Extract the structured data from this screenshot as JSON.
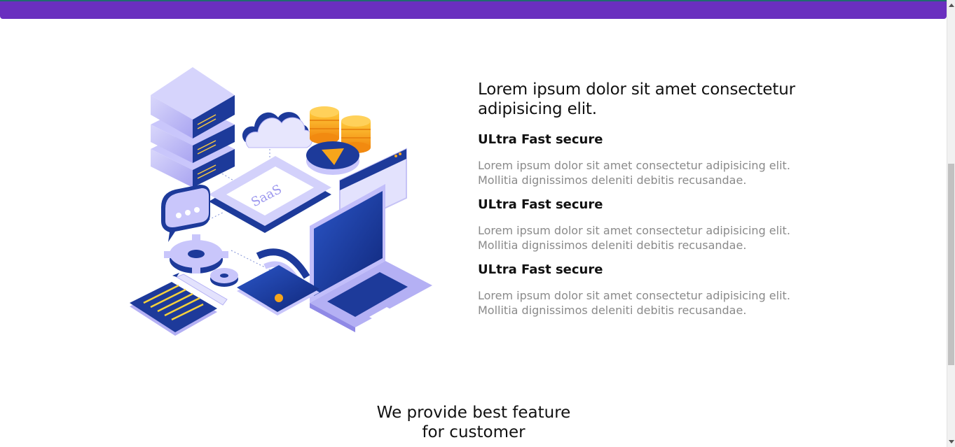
{
  "colors": {
    "topbar": "#6a2fbf",
    "heading": "#111111",
    "muted_text": "#8a8a8a",
    "illustration_blue": "#1d3a9a",
    "illustration_lavender": "#b4b0f4",
    "illustration_orange": "#f7a51b"
  },
  "illustration": {
    "label": "SaaS",
    "icons": [
      "server-stack-icon",
      "cloud-icon",
      "coins-icon",
      "play-icon",
      "browser-window-icon",
      "chat-bubble-icon",
      "gears-icon",
      "laptop-icon",
      "phone-wifi-icon",
      "notepad-icon",
      "pencil-icon"
    ]
  },
  "about": {
    "heading": "Lorem ipsum dolor sit amet consectetur adipisicing elit.",
    "features": [
      {
        "title": "ULtra Fast secure",
        "desc": "Lorem ipsum dolor sit amet consectetur adipisicing elit. Mollitia dignissimos deleniti debitis recusandae."
      },
      {
        "title": "ULtra Fast secure",
        "desc": "Lorem ipsum dolor sit amet consectetur adipisicing elit. Mollitia dignissimos deleniti debitis recusandae."
      },
      {
        "title": "ULtra Fast secure",
        "desc": "Lorem ipsum dolor sit amet consectetur adipisicing elit. Mollitia dignissimos deleniti debitis recusandae."
      }
    ]
  },
  "features_section": {
    "heading_line1": "We provide best feature",
    "heading_line2": "for customer"
  }
}
